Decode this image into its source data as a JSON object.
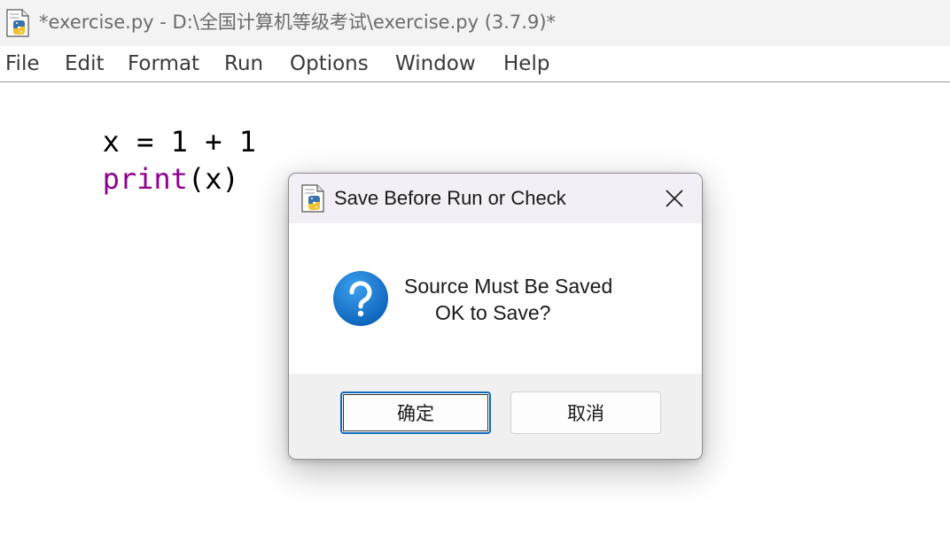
{
  "window": {
    "title": "*exercise.py - D:\\全国计算机等级考试\\exercise.py (3.7.9)*",
    "app_icon": "python-idle-icon"
  },
  "menu": {
    "items": [
      "File",
      "Edit",
      "Format",
      "Run",
      "Options",
      "Window",
      "Help"
    ]
  },
  "editor": {
    "lines": [
      {
        "text": "x = 1 + 1"
      },
      {
        "builtin": "print",
        "rest": "(x)"
      }
    ]
  },
  "dialog": {
    "title": "Save Before Run or Check",
    "icon": "python-idle-icon",
    "message_line1": "Source Must Be Saved",
    "message_line2": "OK to Save?",
    "message_icon": "question-icon",
    "ok_label": "确定",
    "cancel_label": "取消",
    "close_icon": "close-icon"
  },
  "colors": {
    "builtin": "#900090",
    "focus_accent": "#0f6cbd",
    "question_blue": "#1a78d4"
  }
}
